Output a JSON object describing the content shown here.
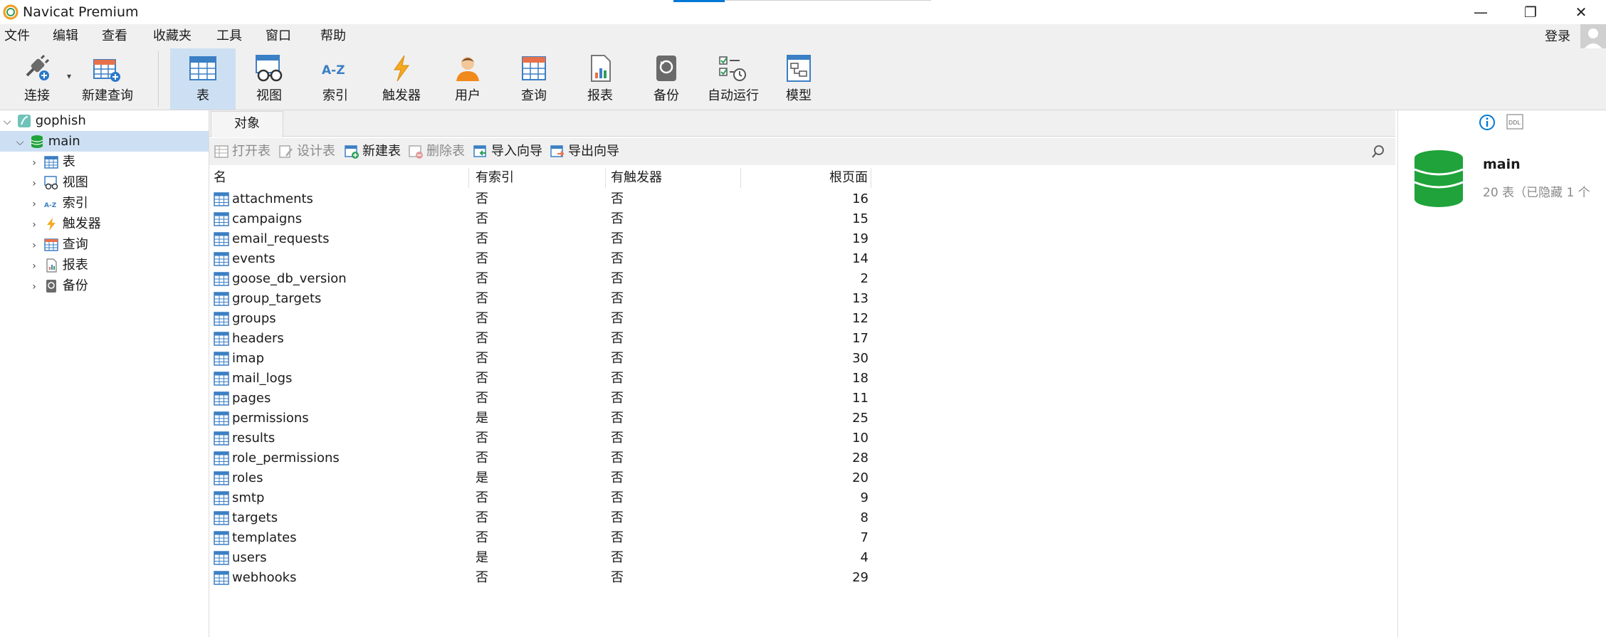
{
  "window": {
    "title": "Navicat Premium",
    "minimize_glyph": "—",
    "restore_glyph": "❐",
    "close_glyph": "✕"
  },
  "menu": [
    "文件",
    "编辑",
    "查看",
    "收藏夹",
    "工具",
    "窗口",
    "帮助"
  ],
  "user": {
    "login_label": "登录"
  },
  "toolbar": {
    "connect": "连接",
    "new_query": "新建查询",
    "table": "表",
    "view": "视图",
    "index": "索引",
    "trigger": "触发器",
    "user": "用户",
    "query": "查询",
    "report": "报表",
    "backup": "备份",
    "automation": "自动运行",
    "model": "模型",
    "active": "表"
  },
  "tree": {
    "connection": "gophish",
    "database": "main",
    "items": [
      "表",
      "视图",
      "索引",
      "触发器",
      "查询",
      "报表",
      "备份"
    ]
  },
  "tabs": {
    "objects": "对象"
  },
  "object_toolbar": {
    "open_table": "打开表",
    "design_table": "设计表",
    "new_table": "新建表",
    "delete_table": "删除表",
    "import_wizard": "导入向导",
    "export_wizard": "导出向导"
  },
  "grid": {
    "columns": [
      "名",
      "有索引",
      "有触发器",
      "根页面"
    ],
    "rows": [
      {
        "name": "attachments",
        "has_index": "否",
        "has_trigger": "否",
        "root_page": "16"
      },
      {
        "name": "campaigns",
        "has_index": "否",
        "has_trigger": "否",
        "root_page": "15"
      },
      {
        "name": "email_requests",
        "has_index": "否",
        "has_trigger": "否",
        "root_page": "19"
      },
      {
        "name": "events",
        "has_index": "否",
        "has_trigger": "否",
        "root_page": "14"
      },
      {
        "name": "goose_db_version",
        "has_index": "否",
        "has_trigger": "否",
        "root_page": "2"
      },
      {
        "name": "group_targets",
        "has_index": "否",
        "has_trigger": "否",
        "root_page": "13"
      },
      {
        "name": "groups",
        "has_index": "否",
        "has_trigger": "否",
        "root_page": "12"
      },
      {
        "name": "headers",
        "has_index": "否",
        "has_trigger": "否",
        "root_page": "17"
      },
      {
        "name": "imap",
        "has_index": "否",
        "has_trigger": "否",
        "root_page": "30"
      },
      {
        "name": "mail_logs",
        "has_index": "否",
        "has_trigger": "否",
        "root_page": "18"
      },
      {
        "name": "pages",
        "has_index": "否",
        "has_trigger": "否",
        "root_page": "11"
      },
      {
        "name": "permissions",
        "has_index": "是",
        "has_trigger": "否",
        "root_page": "25"
      },
      {
        "name": "results",
        "has_index": "否",
        "has_trigger": "否",
        "root_page": "10"
      },
      {
        "name": "role_permissions",
        "has_index": "否",
        "has_trigger": "否",
        "root_page": "28"
      },
      {
        "name": "roles",
        "has_index": "是",
        "has_trigger": "否",
        "root_page": "20"
      },
      {
        "name": "smtp",
        "has_index": "否",
        "has_trigger": "否",
        "root_page": "9"
      },
      {
        "name": "targets",
        "has_index": "否",
        "has_trigger": "否",
        "root_page": "8"
      },
      {
        "name": "templates",
        "has_index": "否",
        "has_trigger": "否",
        "root_page": "7"
      },
      {
        "name": "users",
        "has_index": "是",
        "has_trigger": "否",
        "root_page": "4"
      },
      {
        "name": "webhooks",
        "has_index": "否",
        "has_trigger": "否",
        "root_page": "29"
      }
    ]
  },
  "info_panel": {
    "name": "main",
    "description": "20 表（已隐藏 1 个"
  },
  "colors": {
    "accent": "#0078d7",
    "selection": "#cde0f3",
    "db_green": "#1fa33a",
    "table_blue": "#3b7fc4"
  }
}
